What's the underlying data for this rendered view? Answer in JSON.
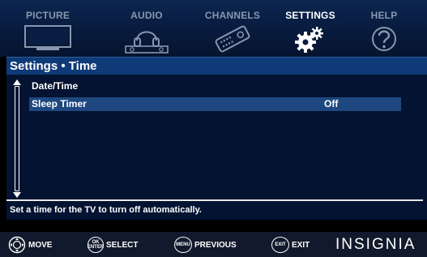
{
  "tabs": [
    {
      "label": "PICTURE",
      "icon": "tv-icon",
      "active": false
    },
    {
      "label": "AUDIO",
      "icon": "headphones-icon",
      "active": false
    },
    {
      "label": "CHANNELS",
      "icon": "remote-control-icon",
      "active": false
    },
    {
      "label": "SETTINGS",
      "icon": "gears-icon",
      "active": true
    },
    {
      "label": "HELP",
      "icon": "help-icon",
      "active": false
    }
  ],
  "panel": {
    "title": "Settings • Time",
    "items": [
      {
        "label": "Date/Time",
        "value": ""
      },
      {
        "label": "Sleep Timer",
        "value": "Off",
        "selected": true
      }
    ],
    "help_text": "Set a time for the TV to turn off automatically."
  },
  "footer": {
    "move": {
      "button": "",
      "label": "MOVE"
    },
    "select": {
      "button_top": "OK",
      "button_bottom": "ENTER",
      "label": "SELECT"
    },
    "previous": {
      "button": "MENU",
      "label": "PREVIOUS"
    },
    "exit": {
      "button": "EXIT",
      "label": "EXIT"
    },
    "brand": "INSIGNIA"
  },
  "colors": {
    "topbar": "#0c2550",
    "panel_bg": "#031331",
    "header_bg": "#0f3a78",
    "selection": "#1e4780",
    "inactive_tab_text": "#8897ae"
  }
}
